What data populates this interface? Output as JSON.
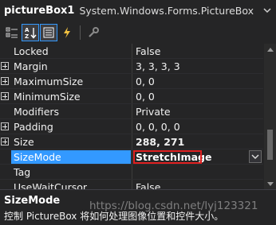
{
  "header": {
    "object_name": "pictureBox1",
    "object_type": "System.Windows.Forms.PictureBox"
  },
  "toolbar": {
    "buttons": [
      {
        "icon": "categorized-icon",
        "active": false
      },
      {
        "icon": "alphabetical-icon",
        "active": true
      },
      {
        "icon": "properties-icon",
        "active": true
      },
      {
        "icon": "events-lightning-icon",
        "active": false
      },
      {
        "icon": "property-pages-wrench-icon",
        "active": false
      }
    ]
  },
  "properties": [
    {
      "name": "Locked",
      "value": "False",
      "expandable": false,
      "bold": false
    },
    {
      "name": "Margin",
      "value": "3, 3, 3, 3",
      "expandable": true,
      "bold": false
    },
    {
      "name": "MaximumSize",
      "value": "0, 0",
      "expandable": true,
      "bold": false
    },
    {
      "name": "MinimumSize",
      "value": "0, 0",
      "expandable": true,
      "bold": false
    },
    {
      "name": "Modifiers",
      "value": "Private",
      "expandable": false,
      "bold": false
    },
    {
      "name": "Padding",
      "value": "0, 0, 0, 0",
      "expandable": true,
      "bold": false
    },
    {
      "name": "Size",
      "value": "288, 271",
      "expandable": true,
      "bold": true
    },
    {
      "name": "SizeMode",
      "value": "StretchImage",
      "expandable": false,
      "bold": true,
      "selected": true
    },
    {
      "name": "Tag",
      "value": "",
      "expandable": false,
      "bold": false
    },
    {
      "name": "UseWaitCursor",
      "value": "False",
      "expandable": false,
      "bold": false
    }
  ],
  "description": {
    "title": "SizeMode",
    "text": "控制 PictureBox 将如何处理图像位置和控件大小。",
    "watermark": "https://blog.csdn.net/lyj123321"
  },
  "colors": {
    "background": "#252526",
    "selection": "#3399ff",
    "highlight_box": "#e02020"
  }
}
